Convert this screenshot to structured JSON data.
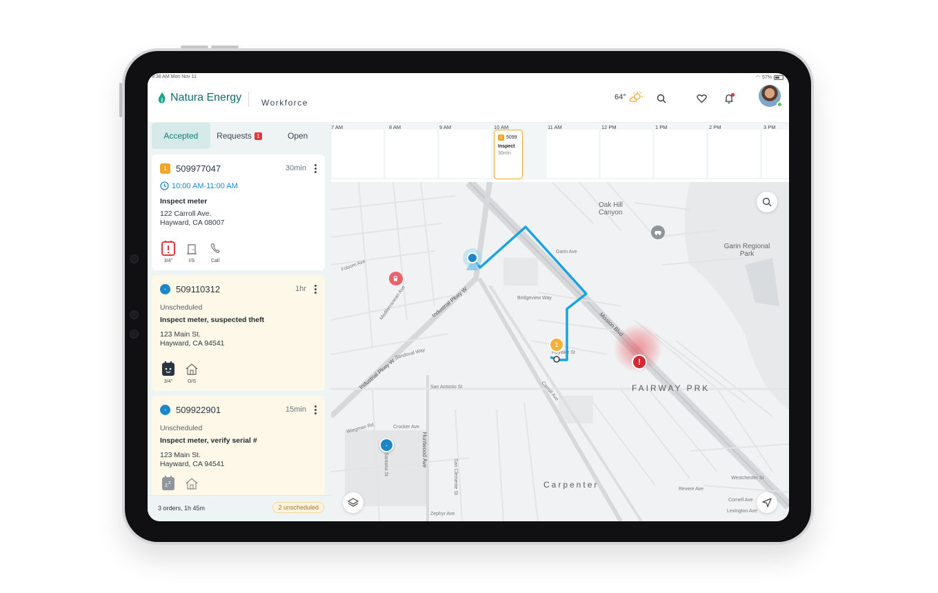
{
  "status_bar": {
    "time": "9:38 AM  Mon Nov 11",
    "battery": "57%"
  },
  "header": {
    "brand": "Natura Energy",
    "app_name": "Workforce",
    "temperature": "64°",
    "icons": [
      "search-icon",
      "heart-icon",
      "bell-icon"
    ],
    "notification_dot_color": "#e5353c"
  },
  "sidebar": {
    "tabs": [
      {
        "label": "Accepted",
        "active": true
      },
      {
        "label": "Requests",
        "badge": "1"
      },
      {
        "label": "Open"
      }
    ],
    "cards": [
      {
        "priority": "1",
        "id": "509977047",
        "duration": "30min",
        "time": "10:00 AM-11:00 AM",
        "title": "Inspect meter",
        "address1": "122 Carroll Ave.",
        "address2": "Hayward, CA 08007",
        "icons": [
          {
            "icon": "alert-timer-icon",
            "label": "3/4\""
          },
          {
            "icon": "door-icon",
            "label": "I/S"
          },
          {
            "icon": "phone-icon",
            "label": "Call"
          }
        ]
      },
      {
        "priority": "-",
        "id": "509110312",
        "duration": "1hr",
        "status": "Unscheduled",
        "title": "Inspect meter, suspected theft",
        "address1": "123 Main St.",
        "address2": "Hayward, CA 94541",
        "icons": [
          {
            "icon": "meter-icon",
            "label": "3/4\""
          },
          {
            "icon": "house-icon",
            "label": "O/S"
          }
        ]
      },
      {
        "priority": "-",
        "id": "509922901",
        "duration": "15min",
        "status": "Unscheduled",
        "title": "Inspect meter, verify serial #",
        "address1": "123 Main St.",
        "address2": "Hayward, CA 94541",
        "icons": [
          {
            "icon": "sleep-meter-icon",
            "label": ""
          },
          {
            "icon": "house-icon",
            "label": ""
          }
        ]
      }
    ],
    "footer": {
      "summary": "3 orders, 1h 45m",
      "pill": "2 unscheduled"
    }
  },
  "timeline": {
    "hours": [
      "7 AM",
      "8 AM",
      "9 AM",
      "10 AM",
      "11 AM",
      "12 PM",
      "1 PM",
      "2 PM",
      "3 PM"
    ],
    "job": {
      "priority": "1",
      "id": "5099",
      "title": "Inspect",
      "duration": "30min"
    }
  },
  "map": {
    "area_labels": [
      "FAIRWAY PRK",
      "Carpenter"
    ],
    "place_labels": [
      "Oak Hill Canyon",
      "Garin Regional Park"
    ],
    "street_labels": [
      "Mission Blvd",
      "Industrial Pkwy W",
      "Industrial Pkwy W...",
      "Huntwood Ave",
      "San Antonio St",
      "Bridgeview Way",
      "Garin Ave",
      "Crocker Ave",
      "Hoylake St",
      "Carroll Ave",
      "Zephyr Ave",
      "Revere Ave",
      "Westchester St",
      "Cornell Ave",
      "Lexington Ave",
      "Folsom Ave",
      "Sandoval Way",
      "Santana St",
      "San Clemente St",
      "Mediterranean Ave",
      "Wiegman Rd"
    ],
    "pins": {
      "orange_label": "1",
      "blue_label": "-",
      "alert_label": "!"
    },
    "route_color": "#1aa3e0"
  }
}
